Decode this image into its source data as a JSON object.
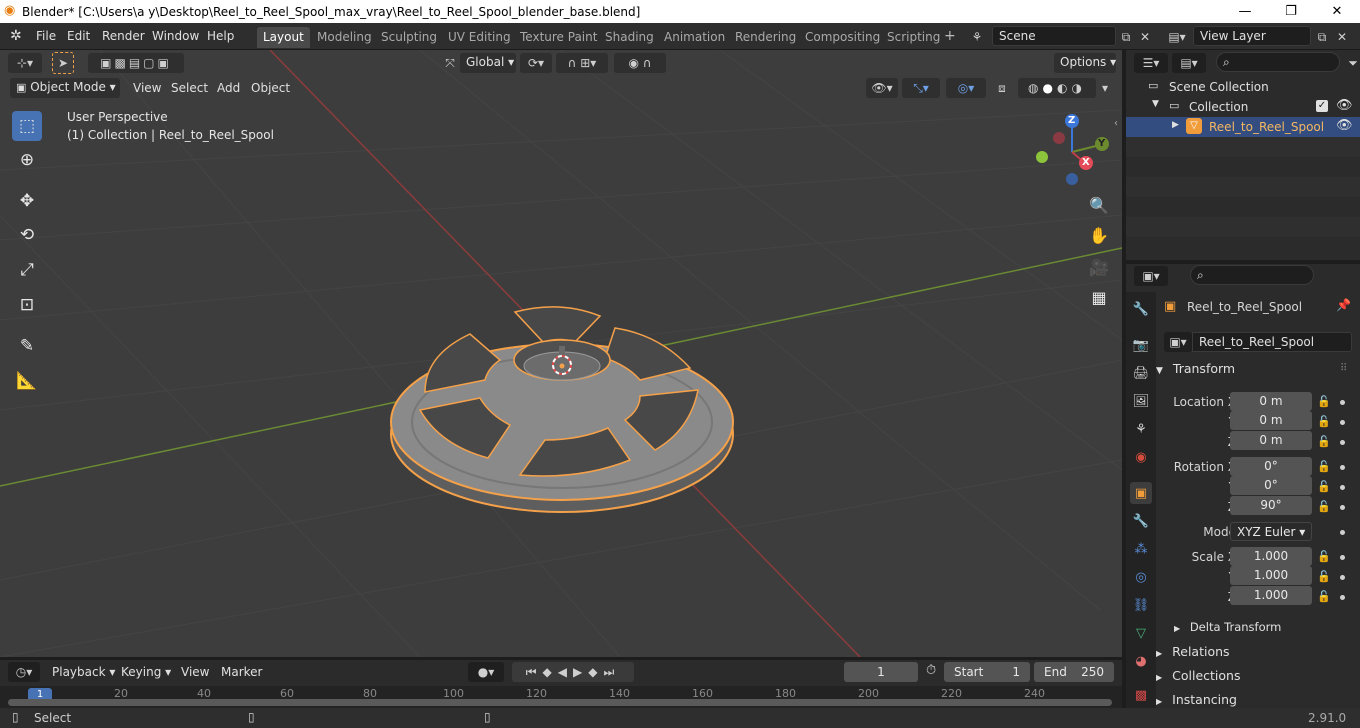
{
  "window": {
    "title": "Blender* [C:\\Users\\a y\\Desktop\\Reel_to_Reel_Spool_max_vray\\Reel_to_Reel_Spool_blender_base.blend]",
    "minimize": "—",
    "maximize": "❐",
    "close": "✕"
  },
  "menu": {
    "file": "File",
    "edit": "Edit",
    "render": "Render",
    "window": "Window",
    "help": "Help"
  },
  "workspaces": [
    "Layout",
    "Modeling",
    "Sculpting",
    "UV Editing",
    "Texture Paint",
    "Shading",
    "Animation",
    "Rendering",
    "Compositing",
    "Scripting"
  ],
  "active_workspace": "Layout",
  "scene": {
    "name": "Scene",
    "view_layer": "View Layer"
  },
  "tool_header": {
    "orientation": "Global",
    "options": "Options"
  },
  "viewport_header": {
    "mode": "Object Mode",
    "view": "View",
    "select": "Select",
    "add": "Add",
    "object": "Object"
  },
  "viewport": {
    "perspective": "User Perspective",
    "context": "(1) Collection | Reel_to_Reel_Spool"
  },
  "gizmo": {
    "x": "X",
    "y": "Y",
    "z": "Z"
  },
  "outliner": {
    "scene_collection": "Scene Collection",
    "collection": "Collection",
    "object": "Reel_to_Reel_Spool"
  },
  "properties": {
    "object_name": "Reel_to_Reel_Spool",
    "data_name": "Reel_to_Reel_Spool",
    "transform_label": "Transform",
    "location_label": "Location X",
    "rotation_label": "Rotation X",
    "scale_label": "Scale X",
    "y_label": "Y",
    "z_label": "Z",
    "location": [
      "0 m",
      "0 m",
      "0 m"
    ],
    "rotation": [
      "0°",
      "0°",
      "90°"
    ],
    "mode_label": "Mode",
    "mode_value": "XYZ Euler",
    "scale": [
      "1.000",
      "1.000",
      "1.000"
    ],
    "delta_transform": "Delta Transform",
    "relations": "Relations",
    "collections": "Collections",
    "instancing": "Instancing"
  },
  "timeline": {
    "playback": "Playback",
    "keying": "Keying",
    "view": "View",
    "marker": "Marker",
    "current_frame": "1",
    "start_label": "Start",
    "start_value": "1",
    "end_label": "End",
    "end_value": "250",
    "ruler": [
      "1",
      "20",
      "40",
      "60",
      "80",
      "100",
      "120",
      "140",
      "160",
      "180",
      "200",
      "220",
      "240"
    ]
  },
  "status": {
    "select": "Select",
    "version": "2.91.0"
  },
  "colors": {
    "accent": "#4772b3",
    "selection": "#f5a14a",
    "x_axis": "#a83c3c",
    "y_axis": "#6c8a2e",
    "z_axis": "#3a77d9"
  }
}
